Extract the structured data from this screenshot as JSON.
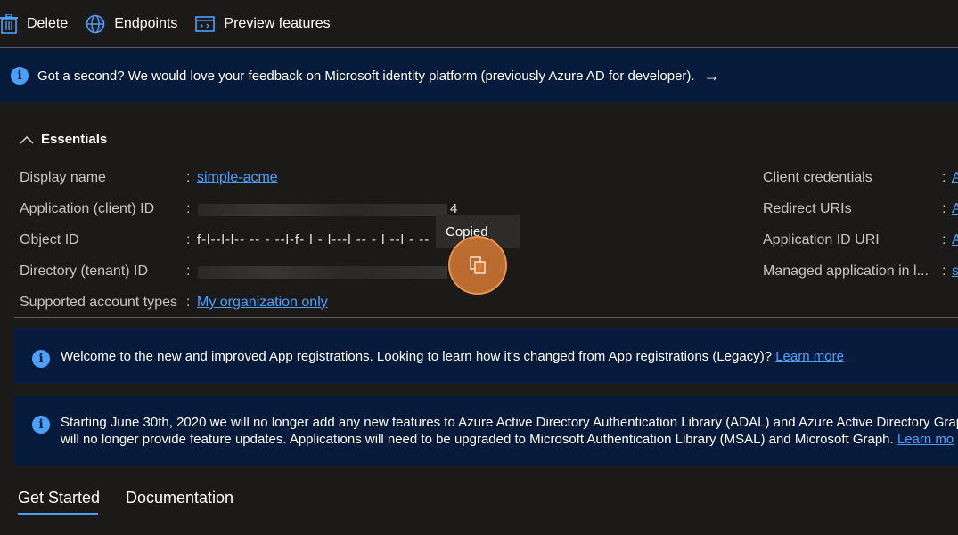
{
  "toolbar": {
    "delete_label": "Delete",
    "endpoints_label": "Endpoints",
    "preview_label": "Preview features"
  },
  "feedback": {
    "text": "Got a second? We would love your feedback on Microsoft identity platform (previously Azure AD for developer).",
    "arrow": "→"
  },
  "essentials": {
    "title": "Essentials",
    "left": [
      {
        "label": "Display name",
        "value": "simple-acme"
      },
      {
        "label": "Application (client) ID",
        "value": "4"
      },
      {
        "label": "Object ID",
        "value": "f-l--l-l-- -- - --l-f- l - l---l -- - l --l - -- -l"
      },
      {
        "label": "Directory (tenant) ID",
        "value": ""
      },
      {
        "label": "Supported account types",
        "value": "My organization only"
      }
    ],
    "right": [
      {
        "label": "Client credentials",
        "value": "A"
      },
      {
        "label": "Redirect URIs",
        "value": "A"
      },
      {
        "label": "Application ID URI",
        "value": "A"
      },
      {
        "label": "Managed application in l...",
        "value": "s"
      }
    ],
    "colon": ":"
  },
  "tooltip": {
    "text": "Copied"
  },
  "banners": {
    "welcome_text": "Welcome to the new and improved App registrations. Looking to learn how it's changed from App registrations (Legacy)?",
    "welcome_link": "Learn more",
    "adal_line1": "Starting June 30th, 2020 we will no longer add any new features to Azure Active Directory Authentication Library (ADAL) and Azure Active Directory Grap",
    "adal_line2": "will no longer provide feature updates. Applications will need to be upgraded to Microsoft Authentication Library (MSAL) and Microsoft Graph.",
    "adal_link": "Learn mo"
  },
  "tabs": [
    {
      "label": "Get Started",
      "active": true
    },
    {
      "label": "Documentation",
      "active": false
    }
  ],
  "colors": {
    "background": "#1b1a19",
    "banner": "#061b3b",
    "link": "#4aa0ff",
    "highlight": "#d67a34"
  }
}
